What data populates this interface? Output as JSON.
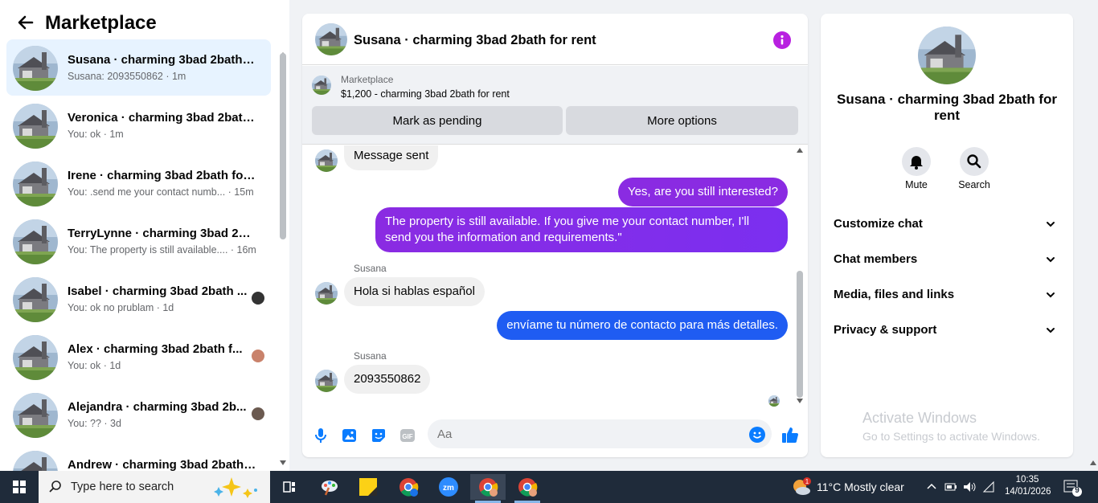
{
  "left": {
    "title": "Marketplace",
    "conversations": [
      {
        "title": "Susana · charming 3bad 2bath f...",
        "subtitle": "Susana: 2093550862 · 1m",
        "active": true
      },
      {
        "title": "Veronica · charming 3bad 2bath ...",
        "subtitle": "You: ok · 1m"
      },
      {
        "title": "Irene · charming 3bad 2bath for ...",
        "subtitle": "You: .send me your contact numb... · 15m"
      },
      {
        "title": "TerryLynne · charming 3bad 2ba...",
        "subtitle": "You: The property is still available.... · 16m"
      },
      {
        "title": "Isabel · charming 3bad 2bath ...",
        "subtitle": "You: ok no prublam · 1d"
      },
      {
        "title": "Alex · charming 3bad 2bath f...",
        "subtitle": "You: ok · 1d"
      },
      {
        "title": "Alejandra · charming 3bad 2b...",
        "subtitle": "You: ?? · 3d"
      },
      {
        "title": "Andrew · charming 3bad 2bath f...",
        "subtitle": ""
      }
    ]
  },
  "chat": {
    "title": "Susana · charming 3bad 2bath for rent",
    "marketplace_label": "Marketplace",
    "listing": "$1,200 - charming 3bad 2bath for rent",
    "btn_pending": "Mark as pending",
    "btn_more": "More options",
    "messages": [
      {
        "text": "Message sent"
      },
      {
        "text": "Yes, are you still interested?"
      },
      {
        "text": "The property is still available. If you give me your contact number, I'll send you the information and requirements.\""
      },
      {
        "sender": "Susana",
        "text": "Hola si hablas español"
      },
      {
        "text": "envíame tu número de contacto para más detalles."
      },
      {
        "sender": "Susana",
        "text": "2093550862"
      }
    ],
    "input_placeholder": "Aa",
    "colors": {
      "purple": "#8a2be2",
      "blue": "#1f5cf2",
      "accent": "#0a7cff"
    }
  },
  "right": {
    "title": "Susana · charming 3bad 2bath for rent",
    "mute": "Mute",
    "search": "Search",
    "sections": [
      "Customize chat",
      "Chat members",
      "Media, files and links",
      "Privacy & support"
    ]
  },
  "watermark": {
    "line1": "Activate Windows",
    "line2": "Go to Settings to activate Windows."
  },
  "taskbar": {
    "search_text": "Type here to search",
    "weather": "11°C  Mostly clear",
    "weather_badge": "1",
    "time": "10:35",
    "date": "14/01/2026",
    "notif_count": "9"
  }
}
